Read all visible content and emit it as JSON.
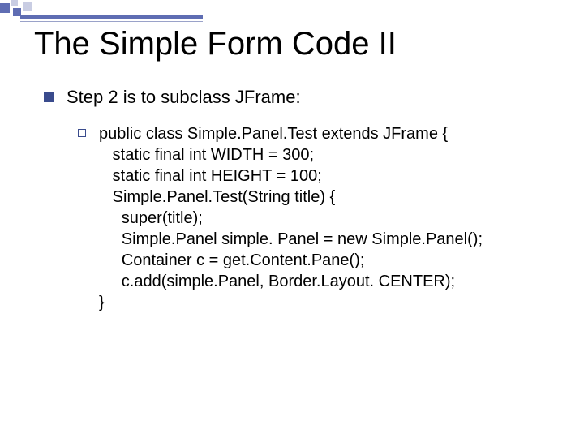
{
  "slide": {
    "title": "The Simple Form Code II",
    "bullet1": "Step 2 is to subclass JFrame:",
    "code": "public class Simple.Panel.Test extends JFrame {\n   static final int WIDTH = 300;\n   static final int HEIGHT = 100;\n   Simple.Panel.Test(String title) {\n     super(title);\n     Simple.Panel simple. Panel = new Simple.Panel();\n     Container c = get.Content.Pane();\n     c.add(simple.Panel, Border.Layout. CENTER);\n}"
  }
}
